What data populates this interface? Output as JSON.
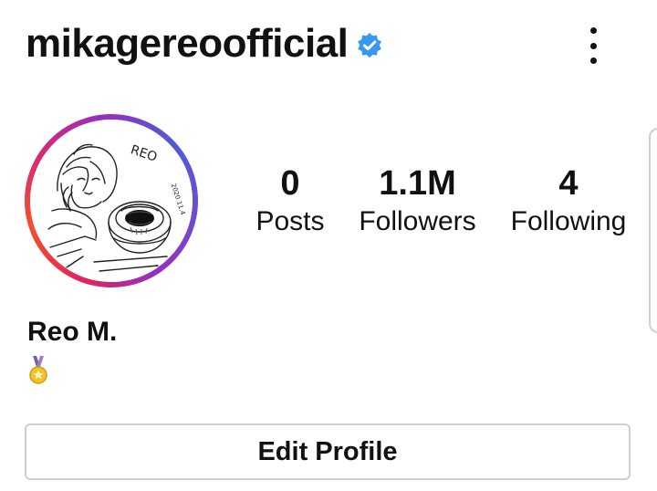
{
  "header": {
    "username": "mikagereoofficial",
    "verified_icon": "verified-badge-icon",
    "menu_icon": "more-vertical-icon"
  },
  "profile": {
    "avatar": "avatar",
    "avatar_text": [
      "REO",
      "2020.11.4"
    ],
    "display_name": "Reo M.",
    "bio_icon": "medal-icon"
  },
  "stats": [
    {
      "value": "0",
      "label": "Posts"
    },
    {
      "value": "1.1M",
      "label": "Followers"
    },
    {
      "value": "4",
      "label": "Following"
    }
  ],
  "actions": {
    "edit_profile_label": "Edit Profile"
  },
  "colors": {
    "verified_blue": "#3897f0",
    "ring_start": "#4f5bd5",
    "ring_end": "#e0245e",
    "button_border": "#cfcfcf"
  }
}
